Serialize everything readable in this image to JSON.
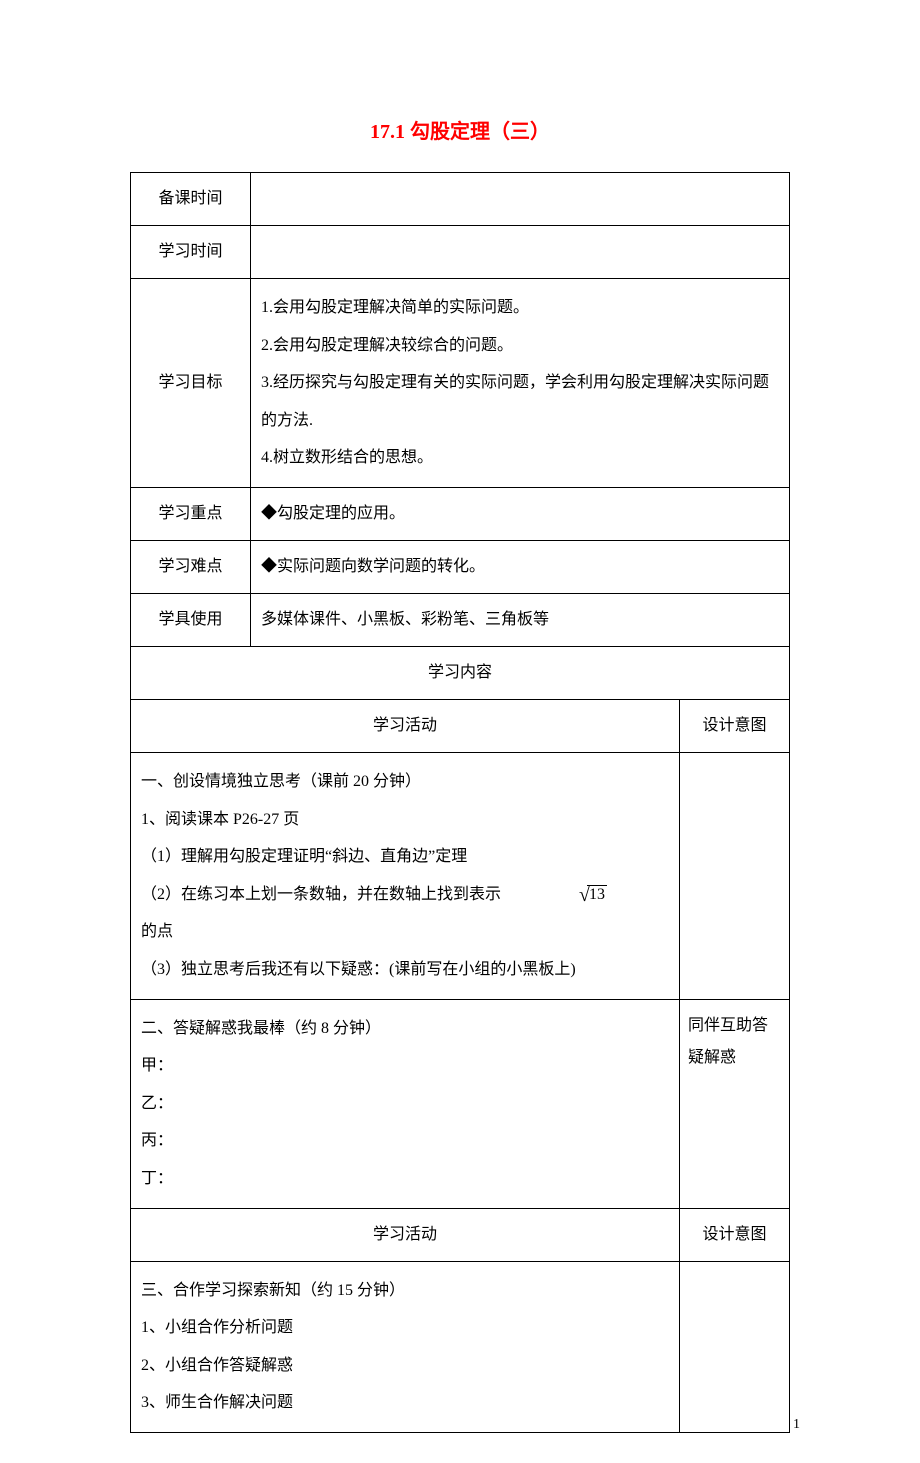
{
  "title": "17.1 勾股定理（三）",
  "labels": {
    "prep_time": "备课时间",
    "study_time": "学习时间",
    "objectives": "学习目标",
    "key_point": "学习重点",
    "difficulty": "学习难点",
    "tools": "学具使用",
    "content_header": "学习内容",
    "activity_header": "学习活动",
    "intent_header": "设计意图"
  },
  "values": {
    "prep_time": "",
    "study_time": "",
    "objectives": [
      "1.会用勾股定理解决简单的实际问题。",
      "2.会用勾股定理解决较综合的问题。",
      "3.经历探究与勾股定理有关的实际问题，学会利用勾股定理解决实际问题的方法.",
      "4.树立数形结合的思想。"
    ],
    "key_point": "◆勾股定理的应用。",
    "difficulty": "◆实际问题向数学问题的转化。",
    "tools": "多媒体课件、小黑板、彩粉笔、三角板等"
  },
  "section1": {
    "heading": "一、创设情境独立思考（课前 20 分钟）",
    "line1": "1、阅读课本 P26-27 页",
    "sub1": "（1）理解用勾股定理证明“斜边、直角边”定理",
    "sub2_prefix": "（2）在练习本上划一条数轴，并在数轴上找到表示",
    "sub2_sqrt": "13",
    "sub2_suffix": "的点",
    "sub3": "（3）独立思考后我还有以下疑惑：(课前写在小组的小黑板上)"
  },
  "section2": {
    "heading": "二、答疑解惑我最棒（约 8 分钟）",
    "lines": [
      "甲：",
      "乙：",
      "丙：",
      "丁："
    ],
    "intent": "同伴互助答疑解惑"
  },
  "section3": {
    "heading": "三、合作学习探索新知（约 15 分钟）",
    "lines": [
      "1、小组合作分析问题",
      "2、小组合作答疑解惑",
      "3、师生合作解决问题"
    ]
  },
  "page_number": "1"
}
